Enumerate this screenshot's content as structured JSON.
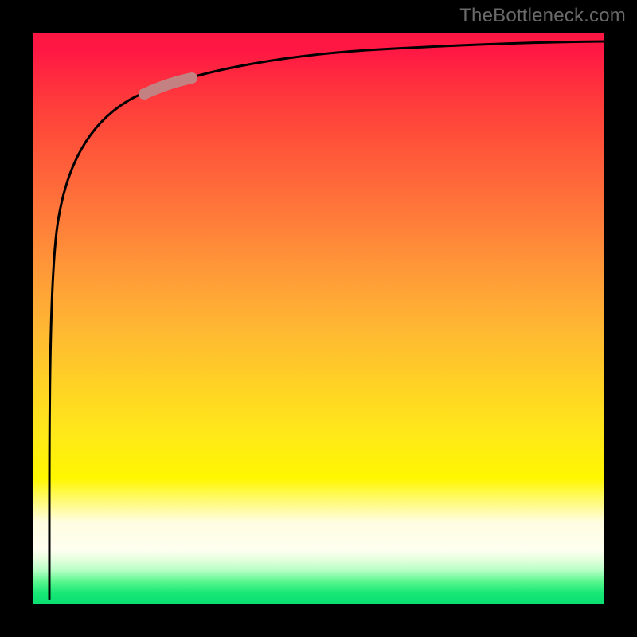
{
  "attribution": "TheBottleneck.com",
  "chart_data": {
    "type": "line",
    "title": "",
    "xlabel": "",
    "ylabel": "",
    "xlim": [
      0,
      100
    ],
    "ylim": [
      0,
      100
    ],
    "grid": false,
    "legend": false,
    "series": [
      {
        "name": "curve",
        "x": [
          0.2,
          0.5,
          1,
          1.5,
          2,
          3,
          4,
          6,
          8,
          10,
          15,
          20,
          25,
          30,
          40,
          50,
          60,
          70,
          80,
          90,
          100
        ],
        "values": [
          1,
          20,
          45,
          58,
          66,
          75,
          80,
          85,
          88,
          90,
          92.5,
          94,
          95,
          95.8,
          96.8,
          97.4,
          97.8,
          98.1,
          98.3,
          98.5,
          98.6
        ]
      },
      {
        "name": "marker-band",
        "x": [
          17,
          18,
          19,
          20,
          21,
          22,
          23,
          24,
          25,
          26
        ],
        "values": [
          90.2,
          90.6,
          90.9,
          91.2,
          91.5,
          91.8,
          92.0,
          92.2,
          92.4,
          92.6
        ]
      }
    ],
    "annotations": []
  },
  "colors": {
    "curve": "#000000",
    "marker": "#c48181",
    "background_top": "#ff1744",
    "background_bottom": "#08df70",
    "page_bg": "#000000",
    "attribution_text": "#6a6a6a"
  }
}
